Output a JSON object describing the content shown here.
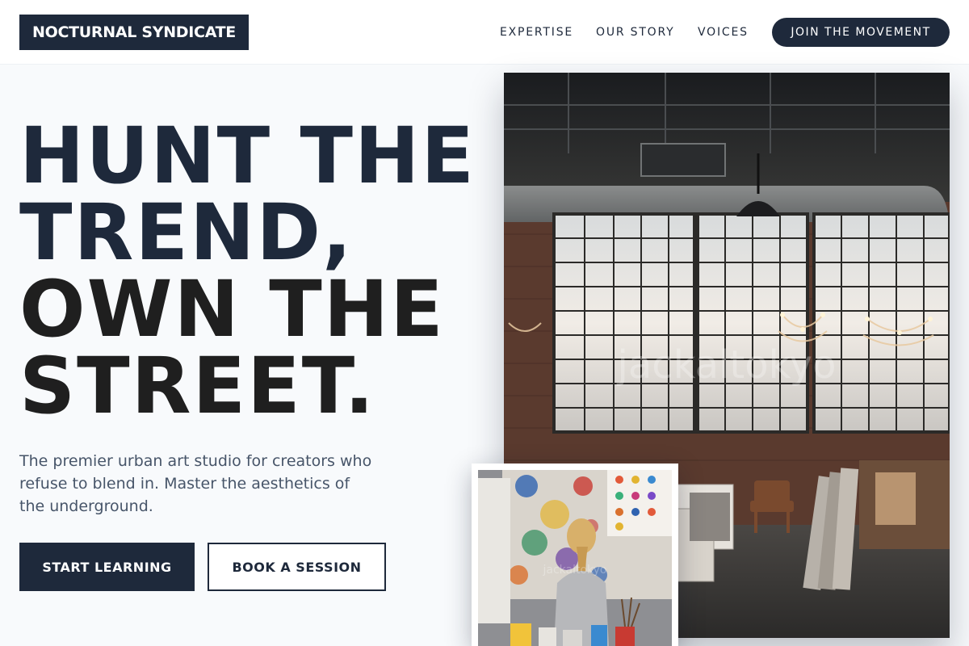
{
  "header": {
    "logo": "NOCTURNAL SYNDICATE",
    "nav": [
      "EXPERTISE",
      "OUR STORY",
      "VOICES"
    ],
    "cta": "JOIN THE MOVEMENT"
  },
  "hero": {
    "headline_lines": [
      "HUNT THE",
      "TREND,",
      "OWN THE",
      "STREET."
    ],
    "subtext": "The premier urban art studio for creators who refuse to blend in. Master the aesthetics of the underground.",
    "primary_button": "START LEARNING",
    "secondary_button": "BOOK A SESSION"
  },
  "images": {
    "main_watermark": "jackaltokyo",
    "inset_watermark": "jackaltokyo"
  },
  "colors": {
    "navy": "#1e293b",
    "background": "#f8fafc",
    "muted_text": "#475569"
  }
}
